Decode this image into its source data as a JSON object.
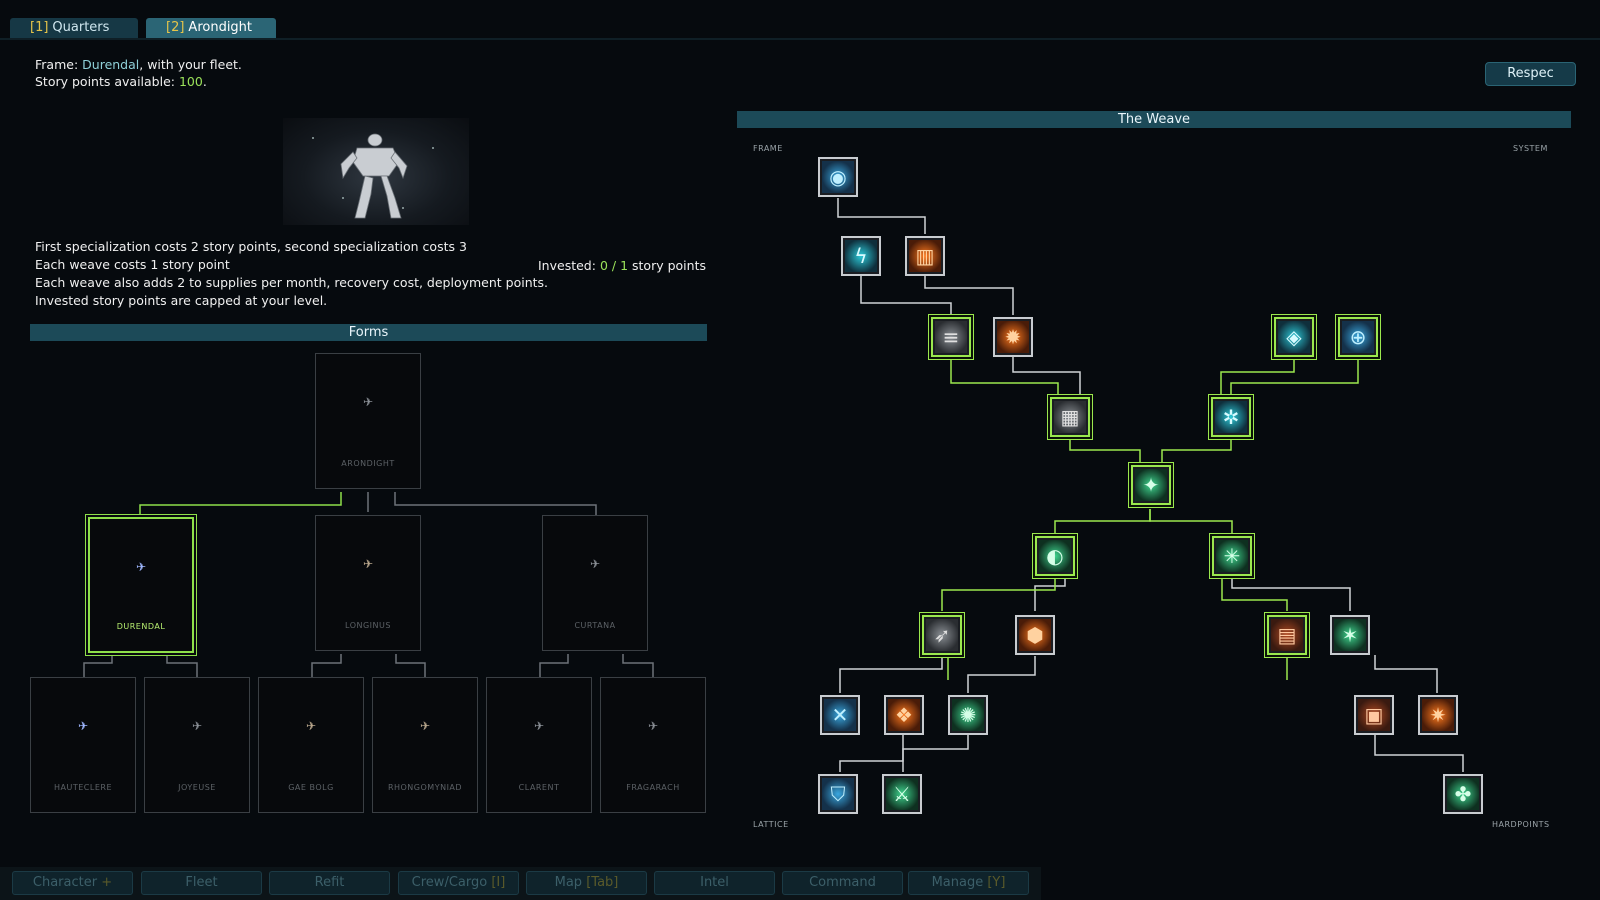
{
  "tabs": [
    {
      "key": "[1]",
      "label": "Quarters"
    },
    {
      "key": "[2]",
      "label": "Arondight"
    }
  ],
  "frame_info": {
    "frame_prefix": "Frame:",
    "frame_name": "Durendal",
    "frame_suffix": ", with your fleet.",
    "sp_prefix": "Story points available:",
    "sp_value": "100",
    "sp_suffix": "."
  },
  "respec_label": "Respec",
  "rules": [
    "First specialization costs 2 story points, second specialization costs 3",
    "Each weave costs 1 story point",
    "Each weave also adds 2 to supplies per month, recovery cost, deployment points.",
    "Invested story points are capped at your level."
  ],
  "invested": {
    "prefix": "Invested:",
    "current": "0",
    "sep": "/",
    "max": "1",
    "suffix": "story points"
  },
  "forms": {
    "title": "Forms",
    "root": "ARONDIGHT",
    "tier1": [
      "DURENDAL",
      "LONGINUS",
      "CURTANA"
    ],
    "tier2": [
      "HAUTECLERE",
      "JOYEUSE",
      "GAE BOLG",
      "RHONGOMYNIAD",
      "CLARENT",
      "FRAGARACH"
    ]
  },
  "weave": {
    "title": "The Weave",
    "labels": {
      "top_left": "FRAME",
      "top_right": "SYSTEM",
      "bottom_left": "LATTICE",
      "bottom_right": "HARDPOINTS"
    },
    "node_icons": [
      "frame-core-icon",
      "arc-lightning-icon",
      "flame-vent-icon",
      "armor-plating-icon",
      "reactor-core-icon",
      "energy-crystal-icon",
      "targeting-reticle-icon",
      "mesh-grid-icon",
      "vortex-icon",
      "weave-hub-icon",
      "shield-pulse-icon",
      "circuit-web-icon",
      "lance-icon",
      "shell-pod-icon",
      "dossier-icon",
      "crystal-shard-icon",
      "crossed-bolts-icon",
      "magma-core-icon",
      "bio-mesh-icon",
      "capsule-icon",
      "thruster-icon",
      "blue-helm-icon",
      "green-blade-icon",
      "green-claw-icon"
    ]
  },
  "nav": [
    {
      "label": "Character",
      "key": "+"
    },
    {
      "label": "Fleet",
      "key": ""
    },
    {
      "label": "Refit",
      "key": ""
    },
    {
      "label": "Crew/Cargo",
      "key": "[I]"
    },
    {
      "label": "Map",
      "key": "[Tab]"
    },
    {
      "label": "Intel",
      "key": ""
    },
    {
      "label": "Command",
      "key": ""
    },
    {
      "label": "Manage",
      "key": "[Y]"
    }
  ],
  "colors": {
    "accent_green": "#9be84e",
    "accent_cyan": "#8fd0d8",
    "bar_teal": "#1c4a58",
    "background": "#060a0e"
  }
}
